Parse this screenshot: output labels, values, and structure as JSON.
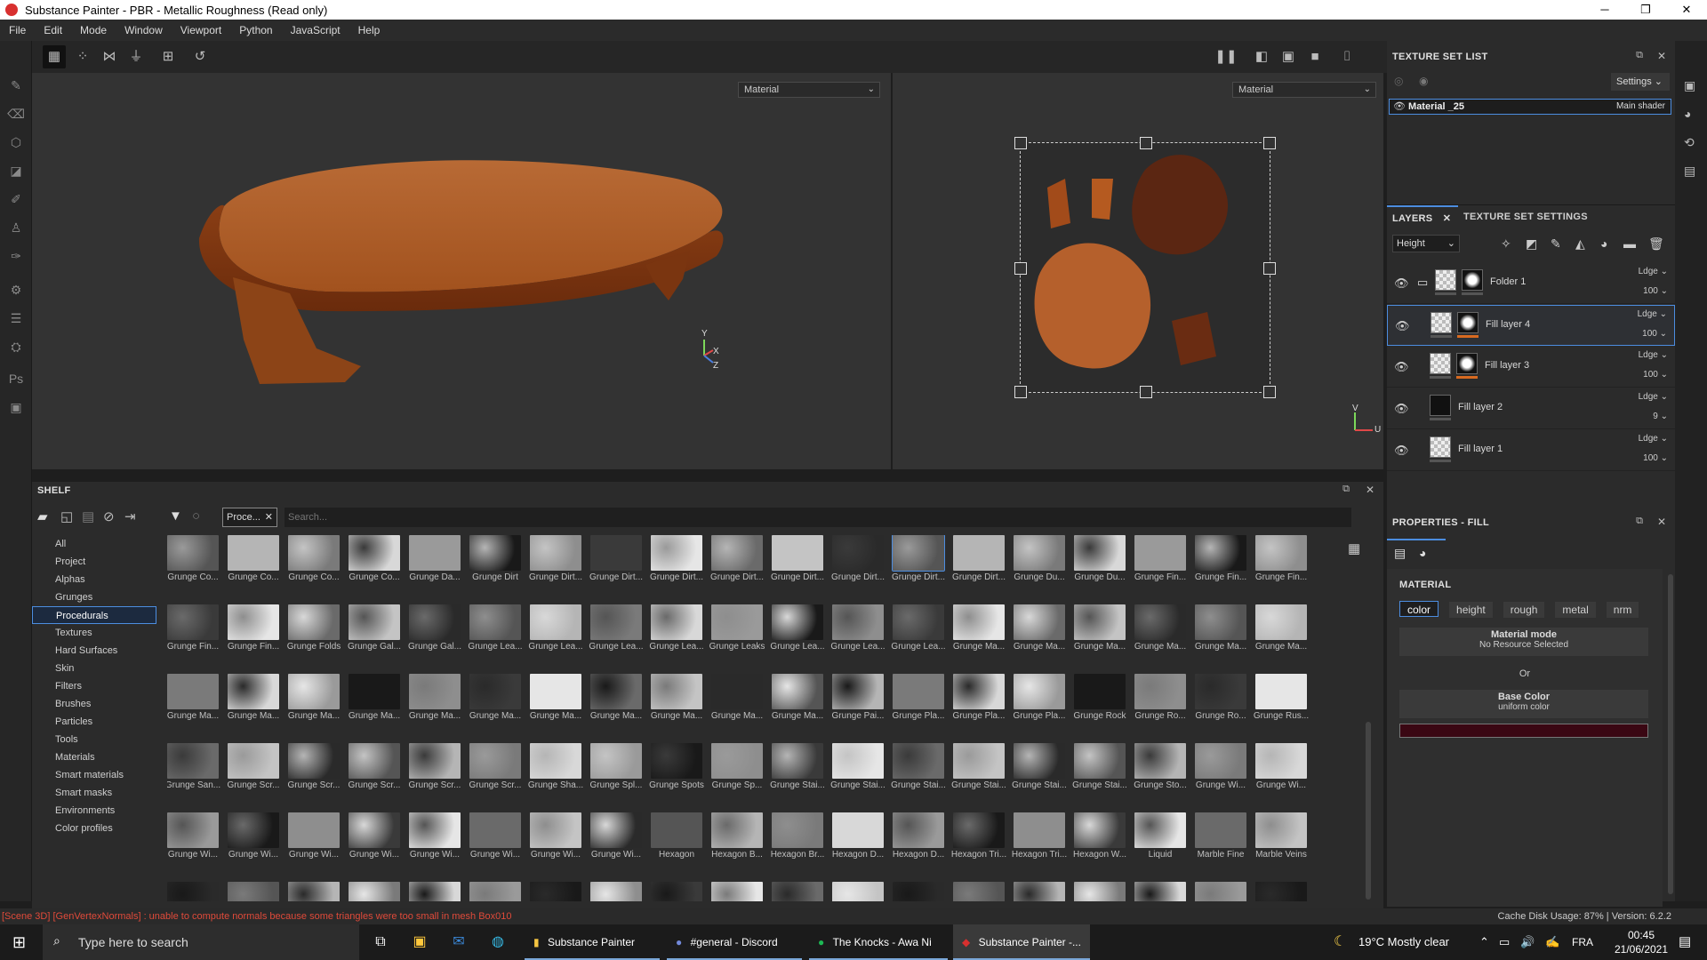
{
  "window": {
    "title": "Substance Painter - PBR - Metallic Roughness (Read only)"
  },
  "menu": [
    "File",
    "Edit",
    "Mode",
    "Window",
    "Viewport",
    "Python",
    "JavaScript",
    "Help"
  ],
  "viewport": {
    "left_mode": "Material",
    "right_mode": "Material",
    "gizmo_3d": {
      "y": "Y",
      "x": "X",
      "z": "Z"
    },
    "gizmo_uv": {
      "v": "V",
      "u": "U"
    }
  },
  "shelf": {
    "title": "SHELF",
    "filter_tag": "Proce...",
    "search_placeholder": "Search...",
    "categories": [
      "All",
      "Project",
      "Alphas",
      "Grunges",
      "Procedurals",
      "Textures",
      "Hard Surfaces",
      "Skin",
      "Filters",
      "Brushes",
      "Particles",
      "Tools",
      "Materials",
      "Smart materials",
      "Smart masks",
      "Environments",
      "Color profiles"
    ],
    "selected_category": "Procedurals",
    "rows": [
      [
        "Grunge Co...",
        "Grunge Co...",
        "Grunge Co...",
        "Grunge Co...",
        "Grunge Da...",
        "Grunge Dirt",
        "Grunge Dirt...",
        "Grunge Dirt...",
        "Grunge Dirt...",
        "Grunge Dirt...",
        "Grunge Dirt...",
        "Grunge Dirt...",
        "Grunge Dirt...",
        "Grunge Dirt...",
        "Grunge Du...",
        "Grunge Du...",
        "Grunge Fin...",
        "Grunge Fin...",
        "Grunge Fin..."
      ],
      [
        "Grunge Fin...",
        "Grunge Fin...",
        "Grunge Folds",
        "Grunge Gal...",
        "Grunge Gal...",
        "Grunge Lea...",
        "Grunge Lea...",
        "Grunge Lea...",
        "Grunge Lea...",
        "Grunge Leaks",
        "Grunge Lea...",
        "Grunge Lea...",
        "Grunge Lea...",
        "Grunge Ma...",
        "Grunge Ma...",
        "Grunge Ma...",
        "Grunge Ma...",
        "Grunge Ma...",
        "Grunge Ma..."
      ],
      [
        "Grunge Ma...",
        "Grunge Ma...",
        "Grunge Ma...",
        "Grunge Ma...",
        "Grunge Ma...",
        "Grunge Ma...",
        "Grunge Ma...",
        "Grunge Ma...",
        "Grunge Ma...",
        "Grunge Ma...",
        "Grunge Ma...",
        "Grunge Pai...",
        "Grunge Pla...",
        "Grunge Pla...",
        "Grunge Pla...",
        "Grunge Rock",
        "Grunge Ro...",
        "Grunge Ro...",
        "Grunge Rus..."
      ],
      [
        "Grunge San...",
        "Grunge Scr...",
        "Grunge Scr...",
        "Grunge Scr...",
        "Grunge Scr...",
        "Grunge Scr...",
        "Grunge Sha...",
        "Grunge Spl...",
        "Grunge Spots",
        "Grunge Sp...",
        "Grunge Stai...",
        "Grunge Stai...",
        "Grunge Stai...",
        "Grunge Stai...",
        "Grunge Stai...",
        "Grunge Stai...",
        "Grunge Sto...",
        "Grunge Wi...",
        "Grunge Wi..."
      ],
      [
        "Grunge Wi...",
        "Grunge Wi...",
        "Grunge Wi...",
        "Grunge Wi...",
        "Grunge Wi...",
        "Grunge Wi...",
        "Grunge Wi...",
        "Grunge Wi...",
        "Hexagon",
        "Hexagon B...",
        "Hexagon Br...",
        "Hexagon D...",
        "Hexagon D...",
        "Hexagon Tri...",
        "Hexagon Tri...",
        "Hexagon W...",
        "Liquid",
        "Marble Fine",
        "Marble Veins"
      ],
      [
        "",
        "",
        "",
        "",
        "",
        "",
        "",
        "",
        "",
        "",
        "",
        "",
        "",
        "",
        "",
        "",
        "",
        "",
        ""
      ]
    ],
    "selected_tile": "Grunge Dirt..."
  },
  "texture_set_list": {
    "title": "TEXTURE SET LIST",
    "settings": "Settings",
    "material": "Material _25",
    "shader": "Main shader"
  },
  "layers": {
    "tab_layers": "LAYERS",
    "tab_settings": "TEXTURE SET SETTINGS",
    "channel": "Height",
    "items": [
      {
        "name": "Folder 1",
        "blend": "Ldge",
        "opacity": "100"
      },
      {
        "name": "Fill layer 4",
        "blend": "Ldge",
        "opacity": "100"
      },
      {
        "name": "Fill layer 3",
        "blend": "Ldge",
        "opacity": "100"
      },
      {
        "name": "Fill layer 2",
        "blend": "Ldge",
        "opacity": "9"
      },
      {
        "name": "Fill layer 1",
        "blend": "Ldge",
        "opacity": "100"
      }
    ]
  },
  "properties": {
    "title": "PROPERTIES - FILL",
    "section": "MATERIAL",
    "chips": [
      "color",
      "height",
      "rough",
      "metal",
      "nrm"
    ],
    "material_mode": "Material mode",
    "no_resource": "No Resource Selected",
    "or": "Or",
    "base_color": "Base Color",
    "uniform": "uniform color",
    "swatch": "#3a0713"
  },
  "status": {
    "error": "[Scene 3D] [GenVertexNormals] : unable to compute normals because some triangles were too small in mesh Box010",
    "cache": "Cache Disk Usage:   87% | Version: 6.2.2"
  },
  "taskbar": {
    "search": "Type here to search",
    "apps": [
      "Substance Painter",
      "#general - Discord",
      "The Knocks - Awa Ni",
      "Substance Painter -..."
    ],
    "weather": "19°C  Mostly clear",
    "lang": "FRA",
    "time": "00:45",
    "date": "21/06/2021"
  },
  "colors": {
    "accent": "#4c8de0",
    "orange": "#d86a20"
  }
}
